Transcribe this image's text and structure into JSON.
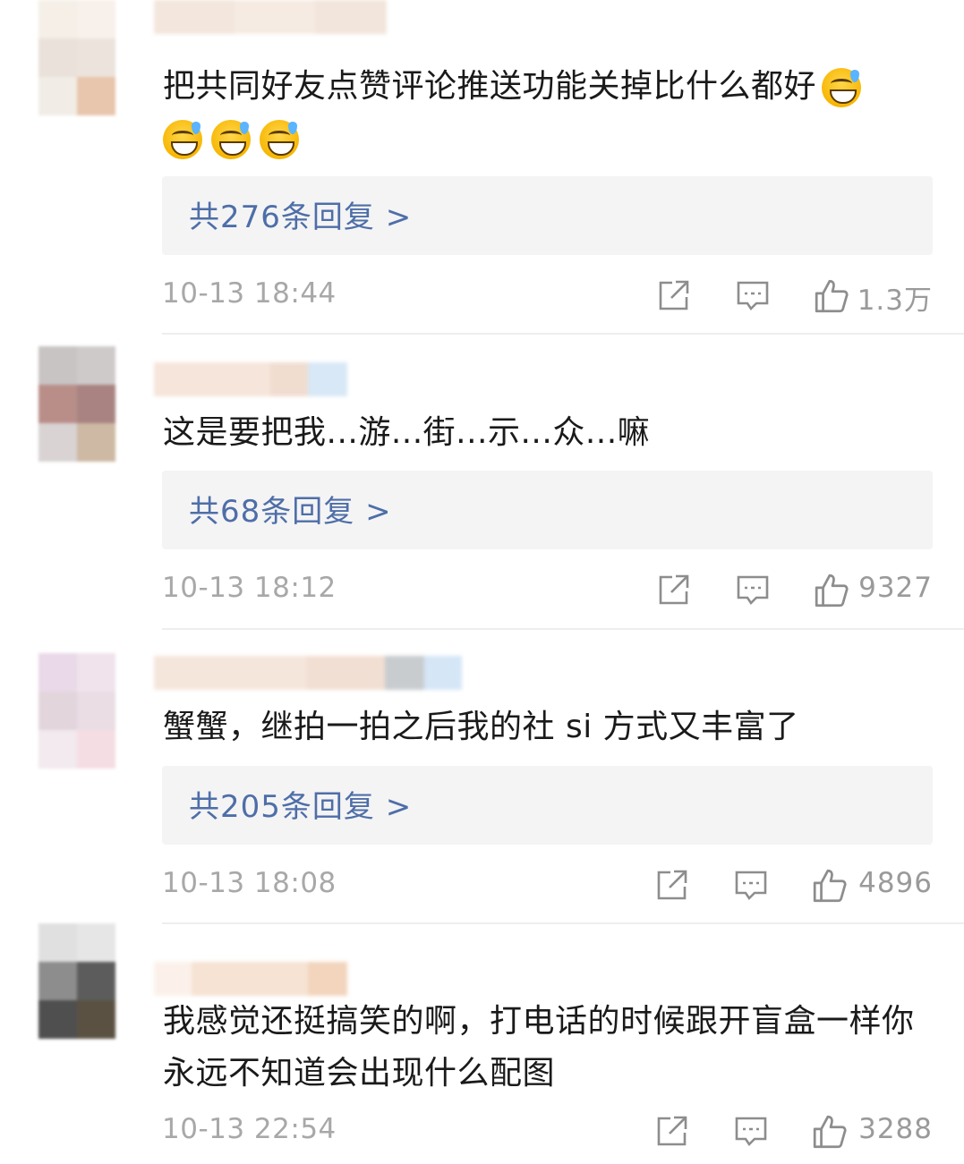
{
  "comments": [
    {
      "text": "把共同好友点赞评论推送功能关掉比什么都好",
      "emoji": [
        "grinning-sweat-emoji",
        "grinning-sweat-emoji",
        "grinning-sweat-emoji",
        "grinning-sweat-emoji"
      ],
      "replies_label": "共276条回复 >",
      "time": "10-13 18:44",
      "likes": "1.3万"
    },
    {
      "text": "这是要把我...游...街...示...众...嘛",
      "replies_label": "共68条回复 >",
      "time": "10-13 18:12",
      "likes": "9327"
    },
    {
      "text": "蟹蟹，继拍一拍之后我的社 si 方式又丰富了",
      "replies_label": "共205条回复 >",
      "time": "10-13 18:08",
      "likes": "4896"
    },
    {
      "text": "我感觉还挺搞笑的啊，打电话的时候跟开盲盒一样你永远不知道会出现什么配图",
      "time": "10-13 22:54",
      "likes": "3288"
    }
  ],
  "icons": {
    "share": "share-icon",
    "comment": "comment-icon",
    "like": "thumbs-up-icon"
  },
  "colors": {
    "reply_link": "#4e6ea8",
    "meta_text": "#a8a8a8",
    "reply_box_bg": "#f4f4f4"
  }
}
